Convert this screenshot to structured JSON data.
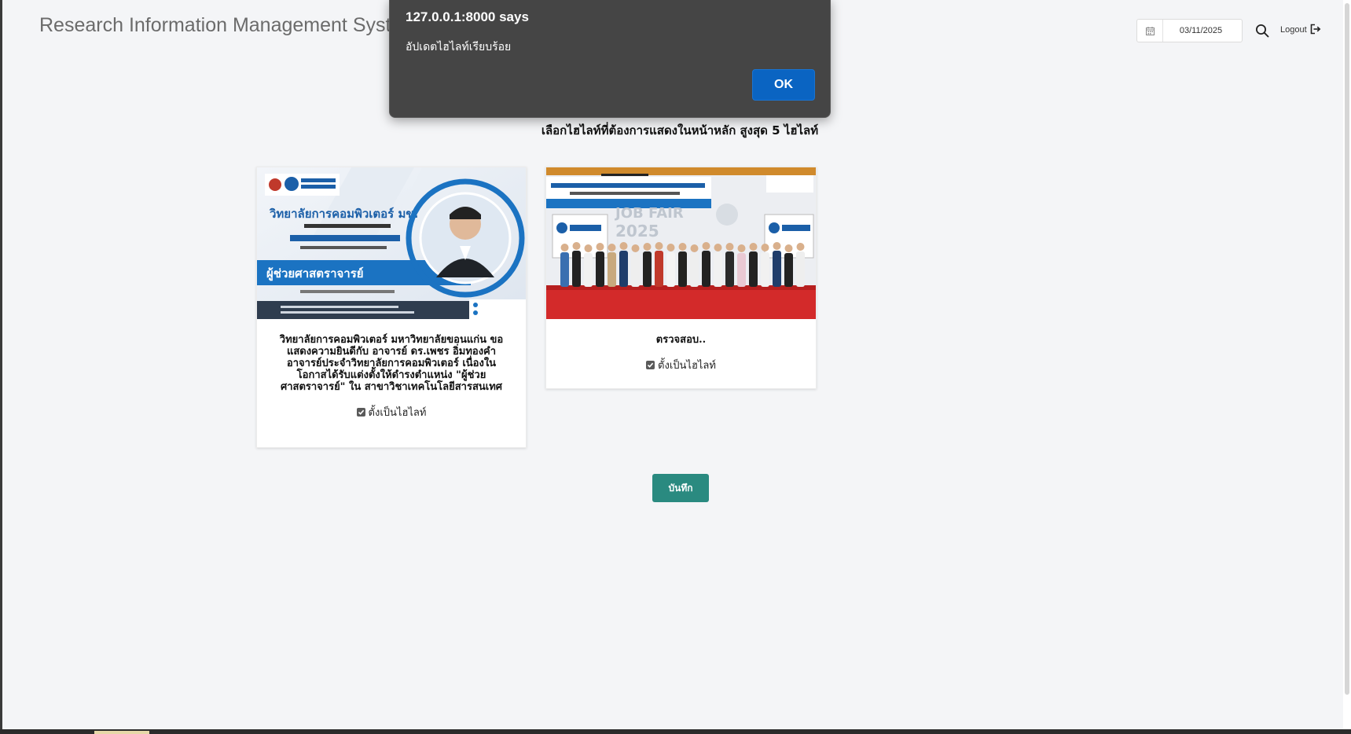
{
  "header": {
    "app_title": "Research Information Management Syste",
    "date_value": "03/11/2025",
    "logout_label": "Logout"
  },
  "main": {
    "heading": "เลือกไฮไลท์ที่ต้องการแสดงในหน้าหลัก สูงสุด 5 ไฮไลท์",
    "cards": [
      {
        "image_alt": "News banner: college of computing congratulations poster",
        "image_texts": [
          "วิทยาลัยการคอมพิวเตอร์ มข.",
          "ผู้ช่วยศาสตราจารย์"
        ],
        "title": "วิทยาลัยการคอมพิวเตอร์ มหาวิทยาลัยขอนแก่น ขอแสดงความยินดีกับ อาจารย์ ดร.เพชร อิ่มทองคำ อาจารย์ประจำวิทยาลัยการคอมพิวเตอร์ เนื่องในโอกาสได้รับแต่งตั้งให้ดำรงตำแหน่ง \"ผู้ช่วยศาสตราจารย์\" ใน สาขาวิชาเทคโนโลยีสารสนเทศ",
        "checkbox_label": "ตั้งเป็นไฮไลท์",
        "checked": true
      },
      {
        "image_alt": "Group photo at Computing Job Fair 2025",
        "image_texts": [
          "JOB FAIR",
          "2025"
        ],
        "title": "ตรวจสอบ..",
        "checkbox_label": "ตั้งเป็นไฮไลท์",
        "checked": true
      }
    ],
    "save_label": "บันทึก"
  },
  "dialog": {
    "title": "127.0.0.1:8000 says",
    "message": "อัปเดตไฮไลท์เรียบร้อย",
    "ok_label": "OK"
  },
  "colors": {
    "accent": "#2a8a80",
    "dialog_bg": "#454545",
    "dialog_button": "#0a64c2",
    "page_bg": "#f4f5f7"
  },
  "icons": [
    "calendar-icon",
    "search-icon",
    "logout-icon",
    "checkbox-checked-icon"
  ]
}
